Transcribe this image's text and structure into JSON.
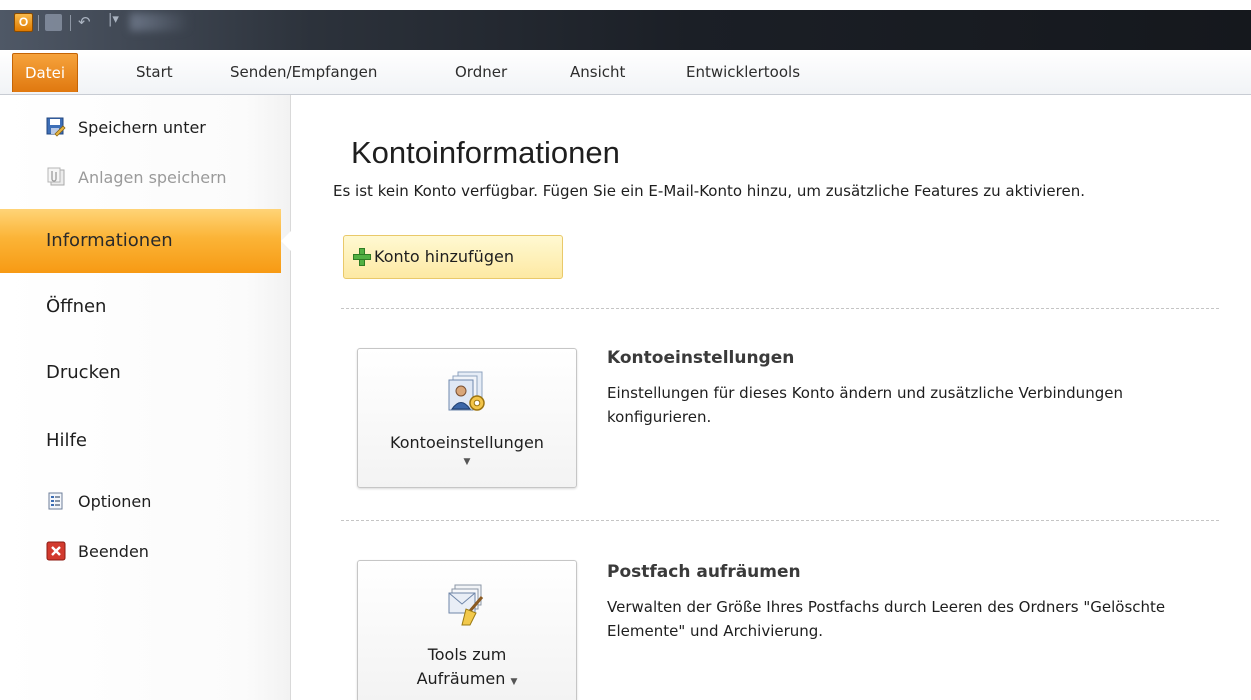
{
  "titlebar": {
    "app_icon_letter": "O",
    "qat_undo_glyph": "↶",
    "qat_customize_glyph": "|▾"
  },
  "ribbon": {
    "tabs": [
      {
        "label": "Datei",
        "active": true
      },
      {
        "label": "Start"
      },
      {
        "label": "Senden/Empfangen"
      },
      {
        "label": "Ordner"
      },
      {
        "label": "Ansicht"
      },
      {
        "label": "Entwicklertools"
      }
    ]
  },
  "backstage": {
    "commands": {
      "save_as": "Speichern unter",
      "save_attachments": "Anlagen speichern",
      "options": "Optionen",
      "exit": "Beenden"
    },
    "nav": [
      {
        "label": "Informationen",
        "selected": true
      },
      {
        "label": "Öffnen"
      },
      {
        "label": "Drucken"
      },
      {
        "label": "Hilfe"
      }
    ]
  },
  "content": {
    "title": "Kontoinformationen",
    "info_text": "Es ist kein Konto verfügbar. Fügen Sie ein E-Mail-Konto hinzu, um zusätzliche Features zu aktivieren.",
    "add_account_label": "Konto hinzufügen",
    "sections": [
      {
        "button_label": "Kontoeinstellungen",
        "title": "Kontoeinstellungen",
        "description": "Einstellungen für dieses Konto ändern und zusätzliche Verbindungen konfigurieren."
      },
      {
        "button_label_line1": "Tools zum",
        "button_label_line2": "Aufräumen",
        "title": "Postfach aufräumen",
        "description": "Verwalten der Größe Ihres Postfachs durch Leeren des Ordners \"Gelöschte Elemente\" und Archivierung."
      }
    ]
  },
  "colors": {
    "accent_orange": "#f79a14",
    "datei_tab": "#e0780f",
    "highlight_yellow": "#fde9a3"
  }
}
